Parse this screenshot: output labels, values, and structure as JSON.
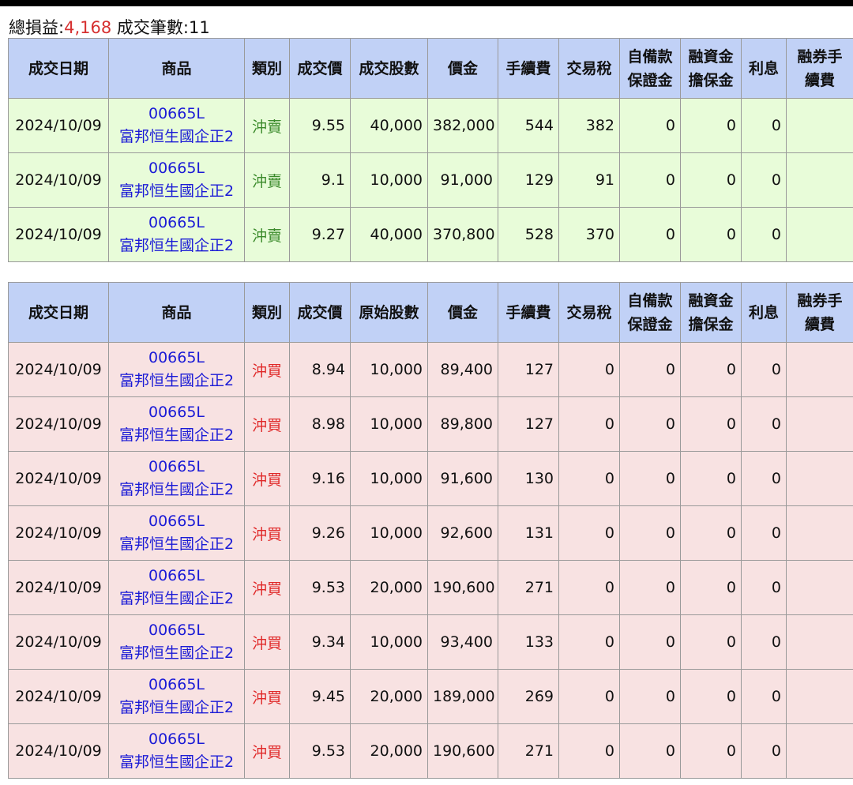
{
  "summary": {
    "pl_label": "總損益:",
    "pl_value": "4,168",
    "count_label": "成交筆數:",
    "count_value": "11"
  },
  "colors": {
    "header": "#c1d1f6",
    "sell_row": "#e8fcd9",
    "buy_row": "#f8e2e2",
    "sell_text": "#3a8a2a",
    "buy_text": "#e02828",
    "link": "#1a1ad6",
    "pl": "#d63030"
  },
  "sell_table": {
    "headers": [
      "成交日期",
      "商品",
      "類別",
      "成交價",
      "成交股數",
      "價金",
      "手續費",
      "交易稅",
      "自備款\n保證金",
      "融資金\n擔保金",
      "利息",
      "融券手續費"
    ],
    "rows": [
      {
        "date": "2024/10/09",
        "code": "00665L",
        "name": "富邦恒生國企正2",
        "kind": "沖賣",
        "price": "9.55",
        "shares": "40,000",
        "amount": "382,000",
        "fee": "544",
        "tax": "382",
        "deposit": "0",
        "margin": "0",
        "interest": "0"
      },
      {
        "date": "2024/10/09",
        "code": "00665L",
        "name": "富邦恒生國企正2",
        "kind": "沖賣",
        "price": "9.1",
        "shares": "10,000",
        "amount": "91,000",
        "fee": "129",
        "tax": "91",
        "deposit": "0",
        "margin": "0",
        "interest": "0"
      },
      {
        "date": "2024/10/09",
        "code": "00665L",
        "name": "富邦恒生國企正2",
        "kind": "沖賣",
        "price": "9.27",
        "shares": "40,000",
        "amount": "370,800",
        "fee": "528",
        "tax": "370",
        "deposit": "0",
        "margin": "0",
        "interest": "0"
      }
    ]
  },
  "buy_table": {
    "headers": [
      "成交日期",
      "商品",
      "類別",
      "成交價",
      "原始股數",
      "價金",
      "手續費",
      "交易稅",
      "自備款\n保證金",
      "融資金\n擔保金",
      "利息",
      "融券手續費"
    ],
    "rows": [
      {
        "date": "2024/10/09",
        "code": "00665L",
        "name": "富邦恒生國企正2",
        "kind": "沖買",
        "price": "8.94",
        "shares": "10,000",
        "amount": "89,400",
        "fee": "127",
        "tax": "0",
        "deposit": "0",
        "margin": "0",
        "interest": "0"
      },
      {
        "date": "2024/10/09",
        "code": "00665L",
        "name": "富邦恒生國企正2",
        "kind": "沖買",
        "price": "8.98",
        "shares": "10,000",
        "amount": "89,800",
        "fee": "127",
        "tax": "0",
        "deposit": "0",
        "margin": "0",
        "interest": "0"
      },
      {
        "date": "2024/10/09",
        "code": "00665L",
        "name": "富邦恒生國企正2",
        "kind": "沖買",
        "price": "9.16",
        "shares": "10,000",
        "amount": "91,600",
        "fee": "130",
        "tax": "0",
        "deposit": "0",
        "margin": "0",
        "interest": "0"
      },
      {
        "date": "2024/10/09",
        "code": "00665L",
        "name": "富邦恒生國企正2",
        "kind": "沖買",
        "price": "9.26",
        "shares": "10,000",
        "amount": "92,600",
        "fee": "131",
        "tax": "0",
        "deposit": "0",
        "margin": "0",
        "interest": "0"
      },
      {
        "date": "2024/10/09",
        "code": "00665L",
        "name": "富邦恒生國企正2",
        "kind": "沖買",
        "price": "9.53",
        "shares": "20,000",
        "amount": "190,600",
        "fee": "271",
        "tax": "0",
        "deposit": "0",
        "margin": "0",
        "interest": "0"
      },
      {
        "date": "2024/10/09",
        "code": "00665L",
        "name": "富邦恒生國企正2",
        "kind": "沖買",
        "price": "9.34",
        "shares": "10,000",
        "amount": "93,400",
        "fee": "133",
        "tax": "0",
        "deposit": "0",
        "margin": "0",
        "interest": "0"
      },
      {
        "date": "2024/10/09",
        "code": "00665L",
        "name": "富邦恒生國企正2",
        "kind": "沖買",
        "price": "9.45",
        "shares": "20,000",
        "amount": "189,000",
        "fee": "269",
        "tax": "0",
        "deposit": "0",
        "margin": "0",
        "interest": "0"
      },
      {
        "date": "2024/10/09",
        "code": "00665L",
        "name": "富邦恒生國企正2",
        "kind": "沖買",
        "price": "9.53",
        "shares": "20,000",
        "amount": "190,600",
        "fee": "271",
        "tax": "0",
        "deposit": "0",
        "margin": "0",
        "interest": "0"
      }
    ]
  }
}
